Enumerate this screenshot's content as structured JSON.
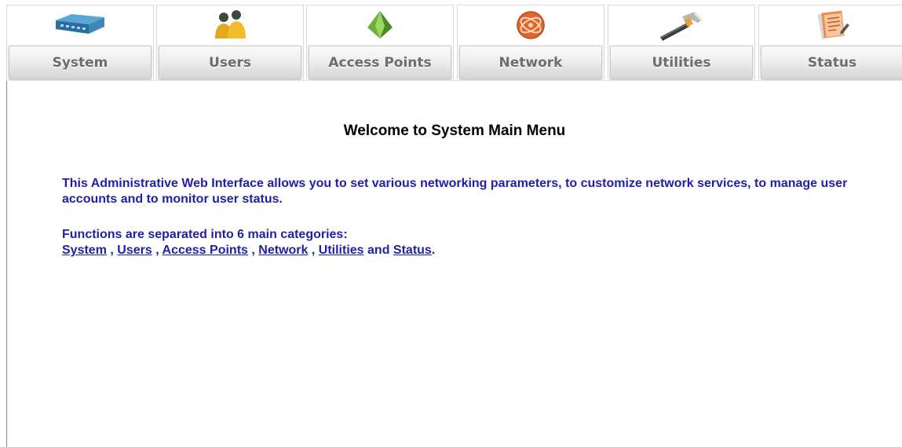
{
  "nav": {
    "tabs": [
      {
        "label": "System",
        "icon": "network-switch-icon"
      },
      {
        "label": "Users",
        "icon": "users-icon"
      },
      {
        "label": "Access Points",
        "icon": "access-point-icon"
      },
      {
        "label": "Network",
        "icon": "network-globe-icon"
      },
      {
        "label": "Utilities",
        "icon": "hammer-icon"
      },
      {
        "label": "Status",
        "icon": "status-notepad-icon"
      }
    ]
  },
  "main": {
    "welcome": "Welcome to System Main Menu",
    "intro": "This Administrative Web Interface allows you to set various networking parameters, to customize network services, to manage user accounts and to monitor user status.",
    "functions_heading": "Functions are separated into 6 main categories:",
    "links": {
      "system": "System",
      "users": "Users",
      "access_points": "Access Points",
      "network": "Network",
      "utilities": "Utilities",
      "status": "Status"
    },
    "separator": ",",
    "and_word": "and",
    "end_punct": "."
  },
  "colors": {
    "body_text": "#1f1fa8",
    "heading": "#000000",
    "tab_label": "#6d6d6d"
  }
}
